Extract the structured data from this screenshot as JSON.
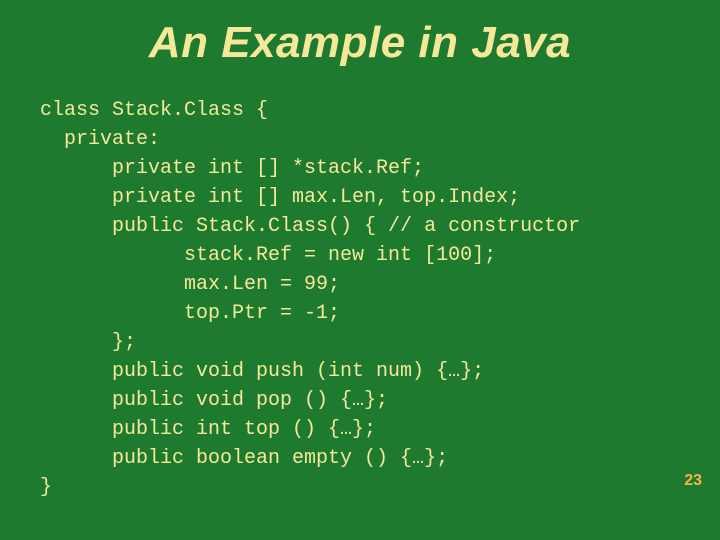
{
  "slide": {
    "title": "An Example in Java",
    "code_lines": [
      "class Stack.Class {",
      "  private:",
      "      private int [] *stack.Ref;",
      "      private int [] max.Len, top.Index;",
      "      public Stack.Class() { // a constructor",
      "            stack.Ref = new int [100];",
      "            max.Len = 99;",
      "            top.Ptr = -1;",
      "      };",
      "      public void push (int num) {…};",
      "      public void pop () {…};",
      "      public int top () {…};",
      "      public boolean empty () {…};",
      "}"
    ],
    "page_number": "23"
  },
  "colors": {
    "background": "#1e7a2e",
    "text": "#f5e89a",
    "page_num": "#f7b24a"
  }
}
